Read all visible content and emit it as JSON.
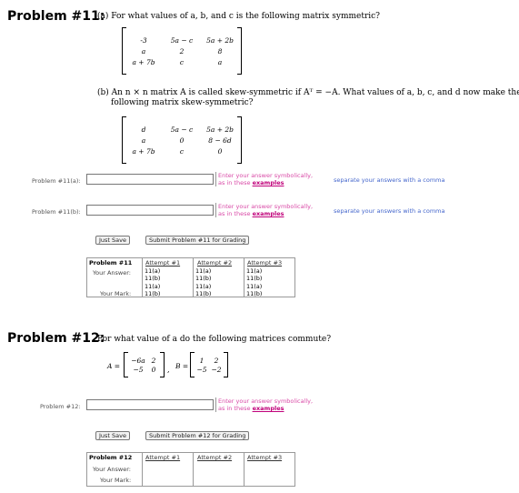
{
  "p11": {
    "title": "Problem #11:",
    "part_a": "(a) For what values of a, b, and c is the following matrix symmetric?",
    "matrix_a": [
      [
        "-3",
        "5a − c",
        "5a + 2b"
      ],
      [
        "a",
        "2",
        "8"
      ],
      [
        "a + 7b",
        "c",
        "a"
      ]
    ],
    "part_b_line1": "(b) An n × n matrix A is called skew-symmetric if Aᵀ = −A. What values of a, b, c, and d now make the",
    "part_b_line2": "following matrix skew-symmetric?",
    "matrix_b": [
      [
        "d",
        "5a − c",
        "5a + 2b"
      ],
      [
        "a",
        "0",
        "8 − 6d"
      ],
      [
        "a + 7b",
        "c",
        "0"
      ]
    ],
    "answers": [
      {
        "label": "Problem #11(a):",
        "value": "",
        "hint1": "Enter your answer symbolically,",
        "hint2": "as in these",
        "hint_link": "examples",
        "sep": "separate your answers with a comma"
      },
      {
        "label": "Problem #11(b):",
        "value": "",
        "hint1": "Enter your answer symbolically,",
        "hint2": "as in these",
        "hint_link": "examples",
        "sep": "separate your answers with a comma"
      }
    ],
    "just_save": "Just Save",
    "submit": "Submit Problem #11 for Grading",
    "attempts": {
      "header": "Problem #11",
      "cols": [
        "Attempt #1",
        "Attempt #2",
        "Attempt #3"
      ],
      "your_answer": "Your Answer:",
      "your_mark": "Your Mark:",
      "cells_a": "11(a)",
      "cells_b": "11(b)"
    }
  },
  "p12": {
    "title": "Problem #12:",
    "question": "For what value of a do the following matrices commute?",
    "A_label": "A =",
    "B_label": "B =",
    "matrix_A": [
      [
        "−6a",
        "2"
      ],
      [
        "−5",
        "0"
      ]
    ],
    "matrix_B": [
      [
        "1",
        "2"
      ],
      [
        "−5",
        "−2"
      ]
    ],
    "comma": ",",
    "answer": {
      "label": "Problem #12:",
      "value": "",
      "hint1": "Enter your answer symbolically,",
      "hint2": "as in these",
      "hint_link": "examples"
    },
    "just_save": "Just Save",
    "submit": "Submit Problem #12 for Grading",
    "attempts": {
      "header": "Problem #12",
      "cols": [
        "Attempt #1",
        "Attempt #2",
        "Attempt #3"
      ],
      "your_answer": "Your Answer:",
      "your_mark": "Your Mark:"
    }
  }
}
